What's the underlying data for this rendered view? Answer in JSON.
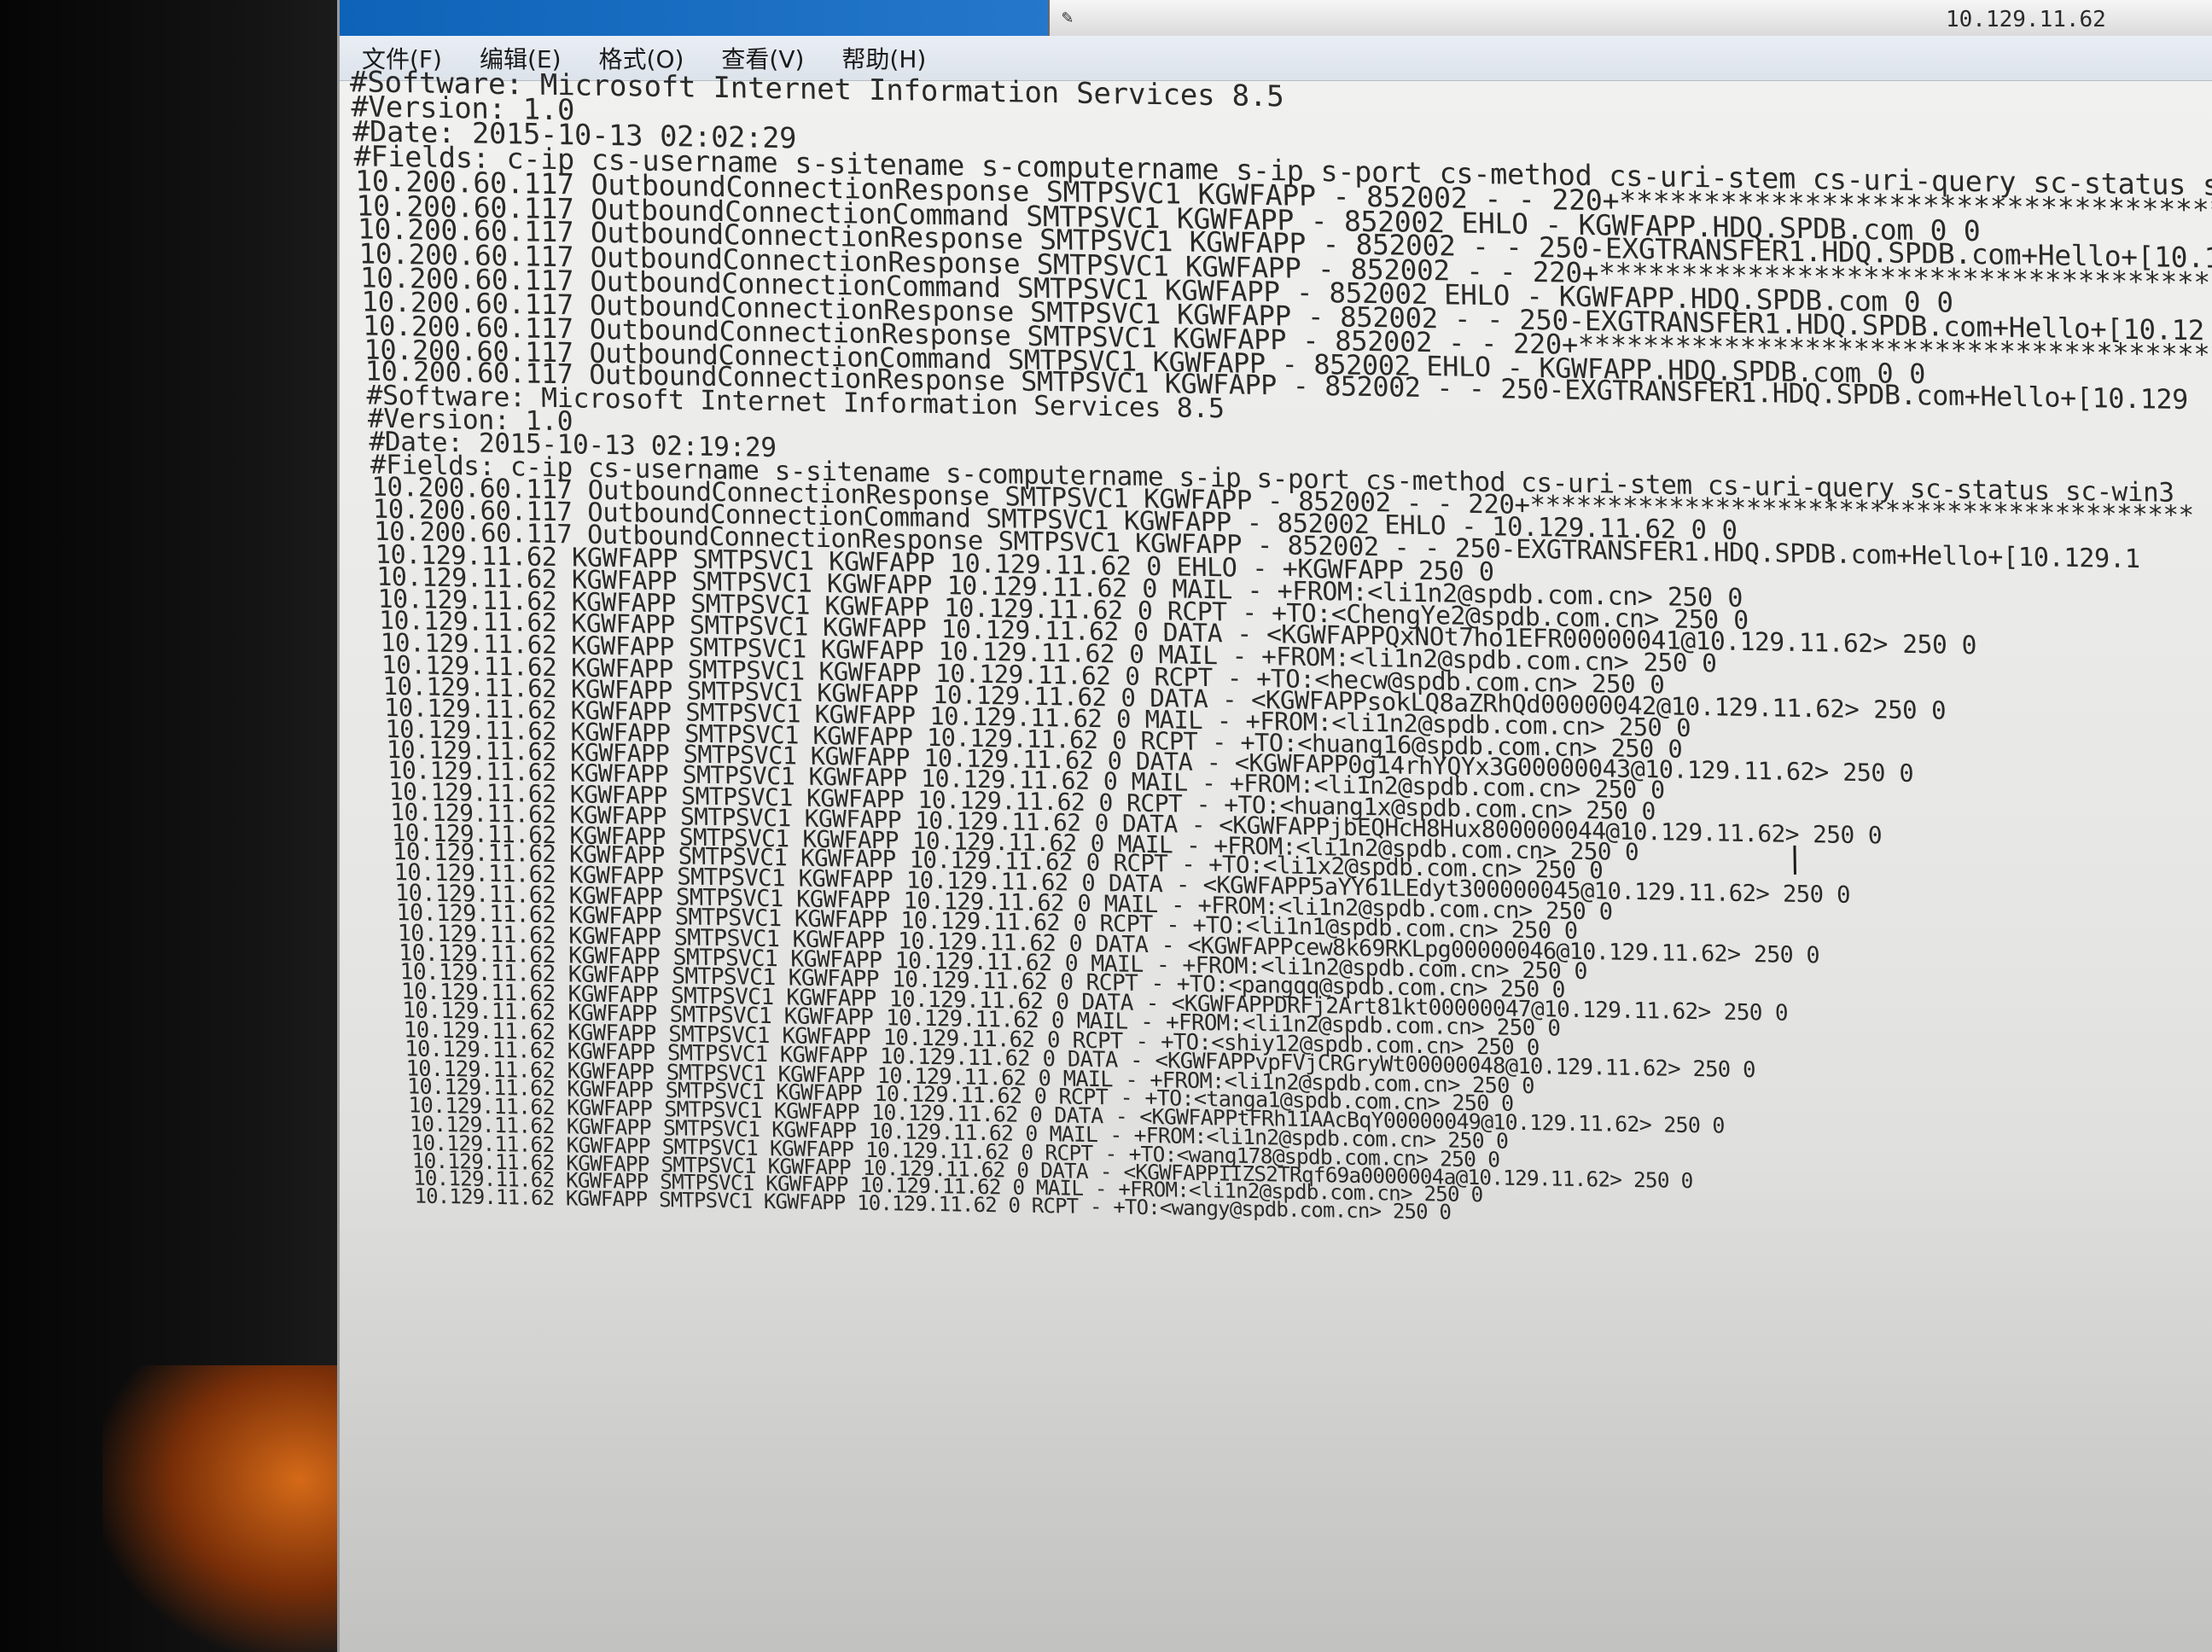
{
  "window": {
    "host_label": "10.129.11.62",
    "app_icon": "notepad-icon"
  },
  "menu": [
    {
      "label": "文件(F)"
    },
    {
      "label": "编辑(E)"
    },
    {
      "label": "格式(O)"
    },
    {
      "label": "查看(V)"
    },
    {
      "label": "帮助(H)"
    }
  ],
  "log_lines": [
    "#Software: Microsoft Internet Information Services 8.5",
    "#Version: 1.0",
    "#Date: 2015-10-13 02:02:29",
    "#Fields: c-ip cs-username s-sitename s-computername s-ip s-port cs-method cs-uri-stem cs-uri-query sc-status sc-",
    "10.200.60.117 OutboundConnectionResponse SMTPSVC1 KGWFAPP - 852002 - - 220+*******************************************",
    "10.200.60.117 OutboundConnectionCommand SMTPSVC1 KGWFAPP - 852002 EHLO - KGWFAPP.HDQ.SPDB.com 0 0",
    "10.200.60.117 OutboundConnectionResponse SMTPSVC1 KGWFAPP - 852002 - - 250-EXGTRANSFER1.HDQ.SPDB.com+Hello+[10.12",
    "10.200.60.117 OutboundConnectionResponse SMTPSVC1 KGWFAPP - 852002 - - 220+*******************************************",
    "10.200.60.117 OutboundConnectionCommand SMTPSVC1 KGWFAPP - 852002 EHLO - KGWFAPP.HDQ.SPDB.com 0 0",
    "10.200.60.117 OutboundConnectionResponse SMTPSVC1 KGWFAPP - 852002 - - 250-EXGTRANSFER1.HDQ.SPDB.com+Hello+[10.12",
    "10.200.60.117 OutboundConnectionResponse SMTPSVC1 KGWFAPP - 852002 - - 220+*******************************************",
    "10.200.60.117 OutboundConnectionCommand SMTPSVC1 KGWFAPP - 852002 EHLO - KGWFAPP.HDQ.SPDB.com 0 0",
    "10.200.60.117 OutboundConnectionResponse SMTPSVC1 KGWFAPP - 852002 - - 250-EXGTRANSFER1.HDQ.SPDB.com+Hello+[10.129",
    "#Software: Microsoft Internet Information Services 8.5",
    "#Version: 1.0",
    "#Date: 2015-10-13 02:19:29",
    "#Fields: c-ip cs-username s-sitename s-computername s-ip s-port cs-method cs-uri-stem cs-uri-query sc-status sc-win3",
    "10.200.60.117 OutboundConnectionResponse SMTPSVC1 KGWFAPP - 852002 - - 220+*******************************************",
    "10.200.60.117 OutboundConnectionCommand SMTPSVC1 KGWFAPP - 852002 EHLO - 10.129.11.62 0 0",
    "10.200.60.117 OutboundConnectionResponse SMTPSVC1 KGWFAPP - 852002 - - 250-EXGTRANSFER1.HDQ.SPDB.com+Hello+[10.129.1",
    "10.129.11.62 KGWFAPP SMTPSVC1 KGWFAPP 10.129.11.62 0 EHLO - +KGWFAPP 250 0",
    "10.129.11.62 KGWFAPP SMTPSVC1 KGWFAPP 10.129.11.62 0 MAIL - +FROM:<li1n2@spdb.com.cn> 250 0",
    "10.129.11.62 KGWFAPP SMTPSVC1 KGWFAPP 10.129.11.62 0 RCPT - +TO:<ChengYe2@spdb.com.cn> 250 0",
    "10.129.11.62 KGWFAPP SMTPSVC1 KGWFAPP 10.129.11.62 0 DATA - <KGWFAPPQxNOt7ho1EFR00000041@10.129.11.62> 250 0",
    "10.129.11.62 KGWFAPP SMTPSVC1 KGWFAPP 10.129.11.62 0 MAIL - +FROM:<li1n2@spdb.com.cn> 250 0",
    "10.129.11.62 KGWFAPP SMTPSVC1 KGWFAPP 10.129.11.62 0 RCPT - +TO:<hecw@spdb.com.cn> 250 0",
    "10.129.11.62 KGWFAPP SMTPSVC1 KGWFAPP 10.129.11.62 0 DATA - <KGWFAPPsokLQ8aZRhQd00000042@10.129.11.62> 250 0",
    "10.129.11.62 KGWFAPP SMTPSVC1 KGWFAPP 10.129.11.62 0 MAIL - +FROM:<li1n2@spdb.com.cn> 250 0",
    "10.129.11.62 KGWFAPP SMTPSVC1 KGWFAPP 10.129.11.62 0 RCPT - +TO:<huang16@spdb.com.cn> 250 0",
    "10.129.11.62 KGWFAPP SMTPSVC1 KGWFAPP 10.129.11.62 0 DATA - <KGWFAPP0g14rhYQYx3G00000043@10.129.11.62> 250 0",
    "10.129.11.62 KGWFAPP SMTPSVC1 KGWFAPP 10.129.11.62 0 MAIL - +FROM:<li1n2@spdb.com.cn> 250 0",
    "10.129.11.62 KGWFAPP SMTPSVC1 KGWFAPP 10.129.11.62 0 RCPT - +TO:<huang1x@spdb.com.cn> 250 0",
    "10.129.11.62 KGWFAPP SMTPSVC1 KGWFAPP 10.129.11.62 0 DATA - <KGWFAPPjbEQHcH8Hux800000044@10.129.11.62> 250 0",
    "10.129.11.62 KGWFAPP SMTPSVC1 KGWFAPP 10.129.11.62 0 MAIL - +FROM:<li1n2@spdb.com.cn> 250 0",
    "10.129.11.62 KGWFAPP SMTPSVC1 KGWFAPP 10.129.11.62 0 RCPT - +TO:<li1x2@spdb.com.cn> 250 0",
    "10.129.11.62 KGWFAPP SMTPSVC1 KGWFAPP 10.129.11.62 0 DATA - <KGWFAPP5aYY61LEdyt300000045@10.129.11.62> 250 0",
    "10.129.11.62 KGWFAPP SMTPSVC1 KGWFAPP 10.129.11.62 0 MAIL - +FROM:<li1n2@spdb.com.cn> 250 0",
    "10.129.11.62 KGWFAPP SMTPSVC1 KGWFAPP 10.129.11.62 0 RCPT - +TO:<li1n1@spdb.com.cn> 250 0",
    "10.129.11.62 KGWFAPP SMTPSVC1 KGWFAPP 10.129.11.62 0 DATA - <KGWFAPPcew8k69RKLpg00000046@10.129.11.62> 250 0",
    "10.129.11.62 KGWFAPP SMTPSVC1 KGWFAPP 10.129.11.62 0 MAIL - +FROM:<li1n2@spdb.com.cn> 250 0",
    "10.129.11.62 KGWFAPP SMTPSVC1 KGWFAPP 10.129.11.62 0 RCPT - +TO:<pangqq@spdb.com.cn> 250 0",
    "10.129.11.62 KGWFAPP SMTPSVC1 KGWFAPP 10.129.11.62 0 DATA - <KGWFAPPDRFj2Art81kt00000047@10.129.11.62> 250 0",
    "10.129.11.62 KGWFAPP SMTPSVC1 KGWFAPP 10.129.11.62 0 MAIL - +FROM:<li1n2@spdb.com.cn> 250 0",
    "10.129.11.62 KGWFAPP SMTPSVC1 KGWFAPP 10.129.11.62 0 RCPT - +TO:<shiy12@spdb.com.cn> 250 0",
    "10.129.11.62 KGWFAPP SMTPSVC1 KGWFAPP 10.129.11.62 0 DATA - <KGWFAPPvpFVjCRGryWt00000048@10.129.11.62> 250 0",
    "10.129.11.62 KGWFAPP SMTPSVC1 KGWFAPP 10.129.11.62 0 MAIL - +FROM:<li1n2@spdb.com.cn> 250 0",
    "10.129.11.62 KGWFAPP SMTPSVC1 KGWFAPP 10.129.11.62 0 RCPT - +TO:<tanga1@spdb.com.cn> 250 0",
    "10.129.11.62 KGWFAPP SMTPSVC1 KGWFAPP 10.129.11.62 0 DATA - <KGWFAPPtFRh11AAcBqY00000049@10.129.11.62> 250 0",
    "10.129.11.62 KGWFAPP SMTPSVC1 KGWFAPP 10.129.11.62 0 MAIL - +FROM:<li1n2@spdb.com.cn> 250 0",
    "10.129.11.62 KGWFAPP SMTPSVC1 KGWFAPP 10.129.11.62 0 RCPT - +TO:<wang178@spdb.com.cn> 250 0",
    "10.129.11.62 KGWFAPP SMTPSVC1 KGWFAPP 10.129.11.62 0 DATA - <KGWFAPPIIZS2TRqf69a0000004a@10.129.11.62> 250 0",
    "10.129.11.62 KGWFAPP SMTPSVC1 KGWFAPP 10.129.11.62 0 MAIL - +FROM:<li1n2@spdb.com.cn> 250 0",
    "10.129.11.62 KGWFAPP SMTPSVC1 KGWFAPP 10.129.11.62 0 RCPT - +TO:<wangy@spdb.com.cn> 250 0"
  ]
}
